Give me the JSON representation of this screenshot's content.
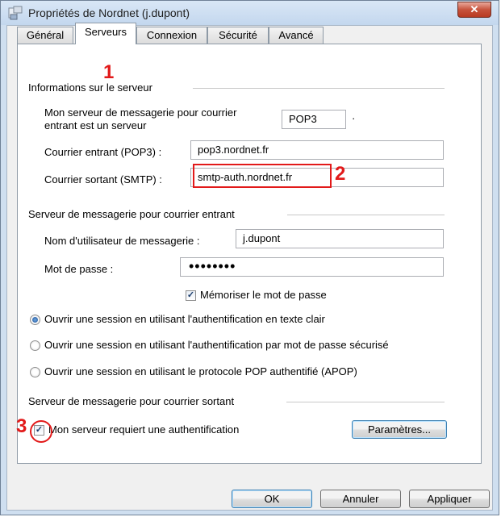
{
  "window": {
    "title": "Propriétés de Nordnet (j.dupont)",
    "close_glyph": "✕"
  },
  "tabs": [
    {
      "label": "Général",
      "active": false
    },
    {
      "label": "Serveurs",
      "active": true
    },
    {
      "label": "Connexion",
      "active": false
    },
    {
      "label": "Sécurité",
      "active": false
    },
    {
      "label": "Avancé",
      "active": false
    }
  ],
  "server_info": {
    "section_title": "Informations sur le serveur",
    "incoming_type_label_1": "Mon serveur de messagerie pour courrier",
    "incoming_type_label_2": "entrant est un serveur",
    "incoming_type_value": "POP3",
    "incoming_type_dot": "·",
    "incoming_label": "Courrier entrant (POP3) :",
    "incoming_value": "pop3.nordnet.fr",
    "outgoing_label": "Courrier sortant (SMTP) :",
    "outgoing_value": "smtp-auth.nordnet.fr"
  },
  "incoming_server": {
    "section_title": "Serveur de messagerie pour courrier entrant",
    "username_label": "Nom d'utilisateur de messagerie :",
    "username_value": "j.dupont",
    "password_label": "Mot de passe :",
    "password_value": "••••••••",
    "remember_label": "Mémoriser le mot de passe",
    "remember_checked": true,
    "auth_options": [
      {
        "label": "Ouvrir une session en utilisant l'authentification en texte clair",
        "selected": true
      },
      {
        "label": "Ouvrir une session en utilisant l'authentification par mot de passe sécurisé",
        "selected": false
      },
      {
        "label": "Ouvrir une session en utilisant le protocole POP authentifié (APOP)",
        "selected": false
      }
    ]
  },
  "outgoing_server": {
    "section_title": "Serveur de messagerie pour courrier sortant",
    "requires_auth_label": "Mon serveur requiert une authentification",
    "requires_auth_checked": true,
    "settings_button": "Paramètres..."
  },
  "check_glyph": "✓",
  "footer": {
    "ok": "OK",
    "cancel": "Annuler",
    "apply": "Appliquer"
  },
  "annotations": {
    "n1": "1",
    "n2": "2",
    "n3": "3",
    "color": "#e21a1a"
  }
}
